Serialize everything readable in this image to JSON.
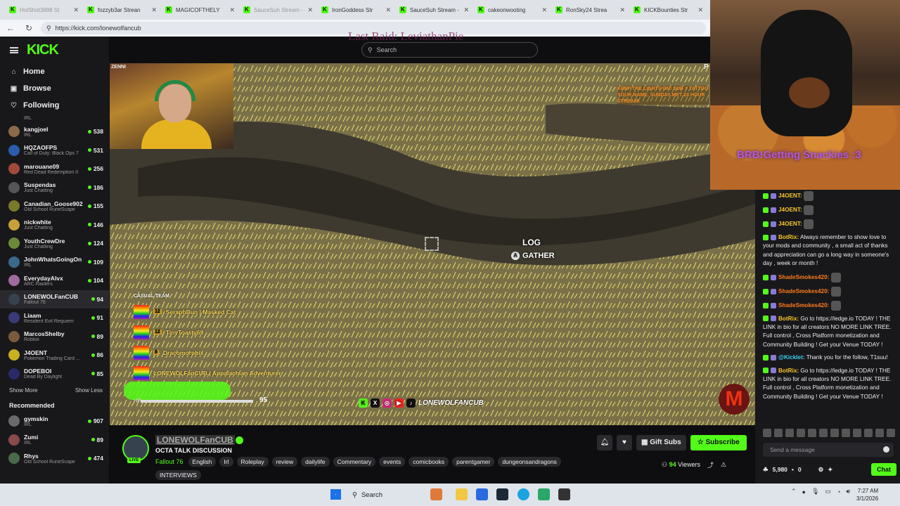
{
  "browser": {
    "tabs": [
      {
        "label": "HotShot3888 St",
        "dim": true
      },
      {
        "label": "fozzyb3ar Strean",
        "dim": false
      },
      {
        "label": "MAGICOFTHELY",
        "dim": false
      },
      {
        "label": "SauceSuh Stream - ",
        "dim": true
      },
      {
        "label": "IronGoddess Str",
        "dim": false
      },
      {
        "label": "SauceSuh Stream - W",
        "dim": false
      },
      {
        "label": "cakeonwooting",
        "dim": false
      },
      {
        "label": "RonSky24 Strea",
        "dim": false
      },
      {
        "label": "KICKBounties Str",
        "dim": false
      }
    ],
    "url": "https://kick.com/lonewolfancub"
  },
  "header": {
    "logo": "KICK",
    "search_placeholder": "Search",
    "raid_overlay": "Last Raid: LeviathanPie"
  },
  "sidebar": {
    "nav": [
      {
        "label": "Home",
        "icon": "home-icon",
        "glyph": "⌂"
      },
      {
        "label": "Browse",
        "icon": "browse-icon",
        "glyph": "▣"
      },
      {
        "label": "Following",
        "icon": "heart-icon",
        "glyph": "♡"
      }
    ],
    "partial_category": "IRL",
    "following": [
      {
        "name": "kangjoel",
        "category": "IRL",
        "viewers": "538",
        "color": "#8a6a4a"
      },
      {
        "name": "HQZAOFPS",
        "category": "Call of Duty: Black Ops 7",
        "viewers": "531",
        "color": "#2a5caa"
      },
      {
        "name": "marouane09",
        "category": "Red Dead Redemption II",
        "viewers": "256",
        "color": "#a04a3a"
      },
      {
        "name": "Suspendas",
        "category": "Just Chatting",
        "viewers": "186",
        "color": "#555555"
      },
      {
        "name": "Canadian_Goose902",
        "category": "Old School RuneScape",
        "viewers": "155",
        "color": "#7a7a2a"
      },
      {
        "name": "nickwhite",
        "category": "Just Chatting",
        "viewers": "146",
        "color": "#c8a03a"
      },
      {
        "name": "YouthCrewDre",
        "category": "Just Chatting",
        "viewers": "124",
        "color": "#6a8a3a"
      },
      {
        "name": "JohnWhatsGoingOn",
        "category": "IRL",
        "viewers": "109",
        "color": "#3a6a8a"
      },
      {
        "name": "EverydayAlvx",
        "category": "ARC Raiders",
        "viewers": "104",
        "color": "#a06aa0"
      },
      {
        "name": "LONEWOLFanCUB",
        "category": "Fallout 76",
        "viewers": "94",
        "color": "#37424f"
      },
      {
        "name": "Liaam",
        "category": "Resident Evil Requiem",
        "viewers": "91",
        "color": "#3a3a7a"
      },
      {
        "name": "MarcosShelby",
        "category": "Roblox",
        "viewers": "89",
        "color": "#7a5a3a"
      },
      {
        "name": "J4OENT",
        "category": "Pokemon Trading Card ...",
        "viewers": "86",
        "color": "#c8b020"
      },
      {
        "name": "DOPEBOI",
        "category": "Dead By Daylight",
        "viewers": "85",
        "color": "#2a2a6a"
      }
    ],
    "show_more": "Show More",
    "show_less": "Show Less",
    "recommended_title": "Recommended",
    "recommended": [
      {
        "name": "gymskin",
        "category": "IRL",
        "viewers": "907",
        "color": "#6a6a6a"
      },
      {
        "name": "Zumi",
        "category": "IRL",
        "viewers": "89",
        "color": "#8a4a4a"
      },
      {
        "name": "Rhys",
        "category": "Old School RuneScape",
        "viewers": "474",
        "color": "#4a6a4a"
      }
    ]
  },
  "video": {
    "cam_label": "ZENNI",
    "prompt_object": "LOG",
    "prompt_action": "GATHER",
    "prompt_button": "A",
    "team_title": "CASUAL TEAM",
    "team_members": [
      {
        "level": "12",
        "name": "SeraphBun | Masked Cat"
      },
      {
        "level": "12",
        "name": "TinyToasty69"
      },
      {
        "level": "8",
        "name": "Dracomorphix"
      },
      {
        "level": "",
        "name": "LONEWOLFanCUB | Appalachian Adventurer"
      }
    ],
    "hp_label": "HP",
    "hp_value": "95",
    "handle": "LONEWOLFANCUB",
    "promo_text": "Keep the lights on! Sub = Tattoo your name. Sunday Met 24 hour stream!",
    "corner_badge": "P"
  },
  "side_cam": {
    "overlay_text": "BRB!Getting Snackies :3"
  },
  "chat": {
    "messages": [
      {
        "user": "J4OENT:",
        "color": "#f7c52b",
        "text": "",
        "emote": true
      },
      {
        "user": "J4OENT:",
        "color": "#f7c52b",
        "text": "",
        "emote": true
      },
      {
        "user": "J4OENT:",
        "color": "#f7c52b",
        "text": "",
        "emote": true
      },
      {
        "user": "BotRix:",
        "color": "#f7c52b",
        "text": "Always remember to show love to your mods and community , a small act of thanks and appreciation can go a long way in someone's day , week or month !",
        "emote": false
      },
      {
        "user": "ShadeSmokes420:",
        "color": "#ff7a1a",
        "text": "",
        "emote": true
      },
      {
        "user": "ShadeSmokes420:",
        "color": "#ff7a1a",
        "text": "",
        "emote": true
      },
      {
        "user": "ShadeSmokes420:",
        "color": "#ff7a1a",
        "text": "",
        "emote": true
      },
      {
        "user": "BotRix:",
        "color": "#f7c52b",
        "text": "Go to https://ledge.io TODAY ! THE LINK in bio for all creators NO MORE LINK TREE. Full control , Cross Platform monetization and Community Building ! Get your Venue TODAY !",
        "emote": false
      },
      {
        "user": "@Kicklet:",
        "color": "#3ad0f0",
        "text": "Thank you for the follow, T1suu!",
        "emote": false
      },
      {
        "user": "BotRix:",
        "color": "#f7c52b",
        "text": "Go to https://ledge.io TODAY ! THE LINK in bio for all creators NO MORE LINK TREE. Full control , Cross Platform monetization and Community Building ! Get your Venue TODAY !",
        "emote": false
      }
    ],
    "input_placeholder": "Send a message",
    "points": "5,980",
    "zero": "0",
    "chat_button": "Chat"
  },
  "stream_info": {
    "streamer": "LONEWOLFanCUB",
    "live_label": "LIVE",
    "title": "OCTA TALK DISCUSSION",
    "category": "Fallout 76",
    "tags": [
      "English",
      "Irl",
      "Roleplay",
      "review",
      "dailylife",
      "Commentary",
      "events",
      "comicbooks",
      "parentgamer",
      "dungeonsandragons",
      "INTERVIEWS"
    ],
    "gift_label": "Gift Subs",
    "subscribe_label": "Subscribe",
    "viewers_count": "94",
    "viewers_label": "Viewers"
  },
  "taskbar": {
    "search": "Search",
    "time": "7:27 AM",
    "date": "3/1/2026"
  },
  "colors": {
    "accent": "#53fc18",
    "background": "#0e0e10",
    "panel": "#18181b"
  }
}
